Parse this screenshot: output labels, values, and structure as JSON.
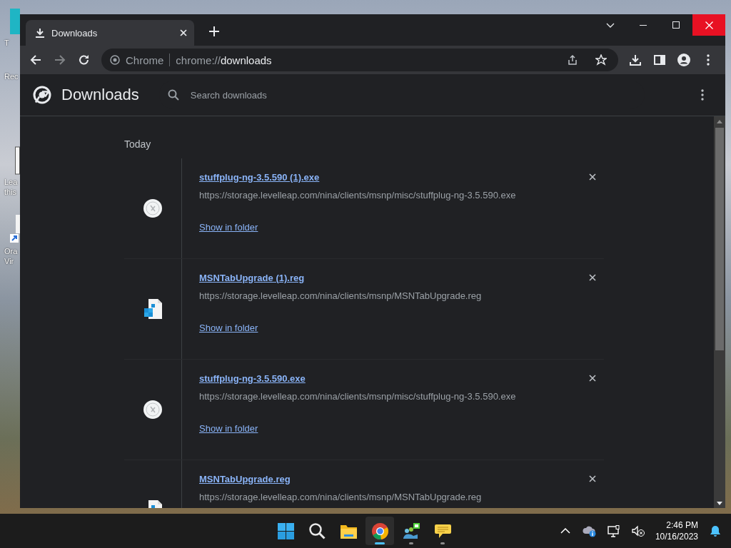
{
  "desktop": {
    "icons": [
      {
        "label": "T",
        "kind": "teal"
      },
      {
        "label": "Rec",
        "kind": "none"
      },
      {
        "label": "Lea this",
        "kind": "doc"
      },
      {
        "label": "Ora Vir",
        "kind": "shortcut"
      }
    ]
  },
  "browser": {
    "tab": {
      "title": "Downloads",
      "selected": true
    },
    "omnibox": {
      "site": "Chrome",
      "url": "chrome://**downloads**"
    }
  },
  "page": {
    "title": "Downloads",
    "search": {
      "placeholder": "Search downloads"
    },
    "section": "Today",
    "downloads": [
      {
        "name": "stuffplug-ng-3.5.590 (1).exe",
        "url": "https://storage.levelleap.com/nina/clients/msnp/misc/stuffplug-ng-3.5.590.exe",
        "action": "Show in folder",
        "kind": "exe"
      },
      {
        "name": "MSNTabUpgrade (1).reg",
        "url": "https://storage.levelleap.com/nina/clients/msnp/MSNTabUpgrade.reg",
        "action": "Show in folder",
        "kind": "reg"
      },
      {
        "name": "stuffplug-ng-3.5.590.exe",
        "url": "https://storage.levelleap.com/nina/clients/msnp/misc/stuffplug-ng-3.5.590.exe",
        "action": "Show in folder",
        "kind": "exe"
      },
      {
        "name": "MSNTabUpgrade.reg",
        "url": "https://storage.levelleap.com/nina/clients/msnp/MSNTabUpgrade.reg",
        "kind": "reg"
      }
    ]
  },
  "taskbar": {
    "apps": [
      {
        "kind": "start",
        "running": false,
        "selected": false
      },
      {
        "kind": "search",
        "running": false,
        "selected": false
      },
      {
        "kind": "folder",
        "running": false,
        "selected": false
      },
      {
        "kind": "chrome",
        "running": true,
        "selected": true
      },
      {
        "kind": "messenger",
        "running": true,
        "selected": false
      },
      {
        "kind": "chat",
        "running": true,
        "selected": false
      }
    ],
    "clock": {
      "time": "2:46 PM",
      "date": "10/16/2023"
    }
  }
}
